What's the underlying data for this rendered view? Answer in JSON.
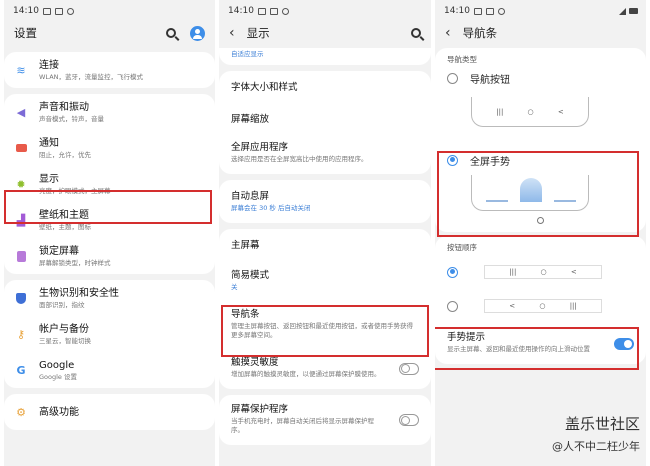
{
  "status": {
    "time": "14:10"
  },
  "panel1": {
    "title": "设置",
    "items": [
      {
        "title": "连接",
        "sub": "WLAN，蓝牙，流量监控，飞行模式"
      },
      {
        "title": "声音和振动",
        "sub": "声音模式，铃声，音量"
      },
      {
        "title": "通知",
        "sub": "阻止，允许，优先"
      },
      {
        "title": "显示",
        "sub": "亮度，护眼模式，主屏幕"
      },
      {
        "title": "壁纸和主题",
        "sub": "壁纸，主题，图标"
      },
      {
        "title": "锁定屏幕",
        "sub": "屏幕解锁类型，时钟样式"
      },
      {
        "title": "生物识别和安全性",
        "sub": "面部识别，指纹"
      },
      {
        "title": "帐户与备份",
        "sub": "三星云，智能切换"
      },
      {
        "title": "Google",
        "sub": "Google 设置"
      },
      {
        "title": "高级功能",
        "sub": ""
      }
    ]
  },
  "panel2": {
    "title": "显示",
    "top_sub": "自适应显示",
    "items": [
      {
        "title": "字体大小和样式",
        "sub": ""
      },
      {
        "title": "屏幕缩放",
        "sub": ""
      },
      {
        "title": "全屏应用程序",
        "sub": "选择应用是否在全屏宽高比中使用的应用程序。"
      },
      {
        "title": "自动息屏",
        "sub": "屏幕会在 30 秒 后自动关闭"
      },
      {
        "title": "主屏幕",
        "sub": ""
      },
      {
        "title": "简易模式",
        "sub": "关"
      },
      {
        "title": "导航条",
        "sub": "管理主屏幕按钮、返回按钮和最近使用按钮，或者使用手势获得更多屏幕空间。"
      },
      {
        "title": "触摸灵敏度",
        "sub": "增加屏幕的触摸灵敏度，以便通过屏幕保护膜使用。"
      },
      {
        "title": "屏幕保护程序",
        "sub": "当手机充电时，屏幕自动关闭后将显示屏幕保护程序。"
      }
    ]
  },
  "panel3": {
    "title": "导航条",
    "nav_type_label": "导航类型",
    "opt_buttons": "导航按钮",
    "opt_gestures": "全屏手势",
    "button_order_label": "按钮顺序",
    "hint_title": "手势提示",
    "hint_sub": "显示主屏幕、返回和最近使用操作的向上滑动位置",
    "glyph_recent": "|||",
    "glyph_home": "○",
    "glyph_back": "<"
  },
  "watermark": {
    "line1": "盖乐世社区",
    "line2": "@人不中二枉少年"
  },
  "colors": {
    "accent": "#3e8ee8",
    "highlight": "#d42e2e"
  }
}
